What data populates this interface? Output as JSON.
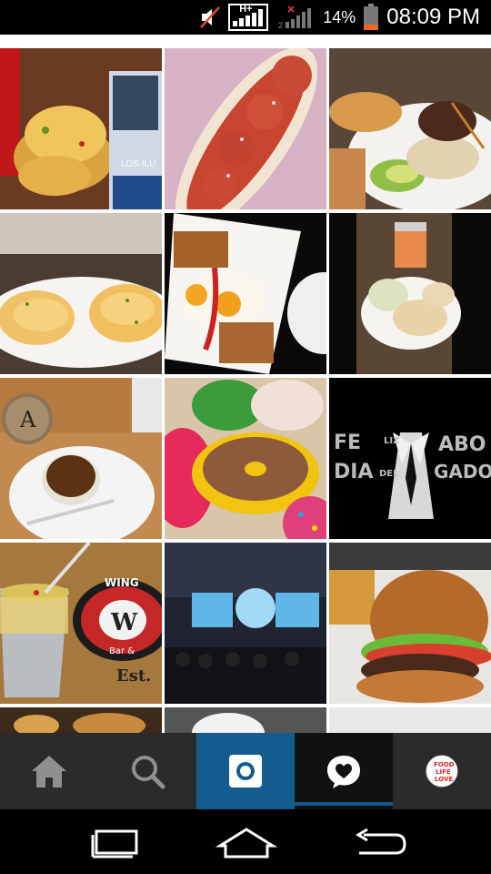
{
  "status_bar": {
    "network": "H+",
    "battery_percent": "14%",
    "time": "08:09 PM",
    "icons": [
      "muted-speaker-icon",
      "signal-hplus-icon",
      "signal-2-icon",
      "battery-icon"
    ]
  },
  "grid": {
    "tiles": [
      {
        "name": "grid-photo-nachos",
        "overlay": "LOS ILU"
      },
      {
        "name": "grid-photo-sub-sandwich",
        "overlay": ""
      },
      {
        "name": "grid-photo-salad-plate",
        "overlay": ""
      },
      {
        "name": "grid-photo-eggs-benedict",
        "overlay": ""
      },
      {
        "name": "grid-photo-fried-eggs-potatoes",
        "overlay": ""
      },
      {
        "name": "grid-photo-bruschetta-drink",
        "overlay": ""
      },
      {
        "name": "grid-photo-creme-brulee",
        "overlay": "A"
      },
      {
        "name": "grid-photo-donuts",
        "overlay": ""
      },
      {
        "name": "grid-photo-dia-del-abogado",
        "text_left_1": "FE",
        "text_left_2": "DIA",
        "text_mid_1": "LIZ",
        "text_mid_2": "DEL",
        "text_right_1": "ABO",
        "text_right_2": "GADO"
      },
      {
        "name": "grid-photo-wings-bucket",
        "overlay_1": "WING",
        "overlay_2": "W",
        "overlay_3": "Bar &",
        "overlay_4": "Est."
      },
      {
        "name": "grid-photo-conference",
        "overlay": ""
      },
      {
        "name": "grid-photo-burger",
        "overlay": ""
      }
    ]
  },
  "bottom_nav": {
    "items": [
      {
        "name": "home",
        "icon": "home-icon"
      },
      {
        "name": "explore",
        "icon": "search-icon"
      },
      {
        "name": "camera",
        "icon": "camera-icon"
      },
      {
        "name": "activity",
        "icon": "heart-bubble-icon"
      },
      {
        "name": "profile",
        "icon": "avatar",
        "avatar_text": [
          "FOOD",
          "LIFE",
          "LOVE"
        ]
      }
    ],
    "active_color": "#145b8e"
  },
  "system_nav": {
    "icons": [
      "recent-apps-icon",
      "home-outline-icon",
      "back-icon"
    ]
  }
}
